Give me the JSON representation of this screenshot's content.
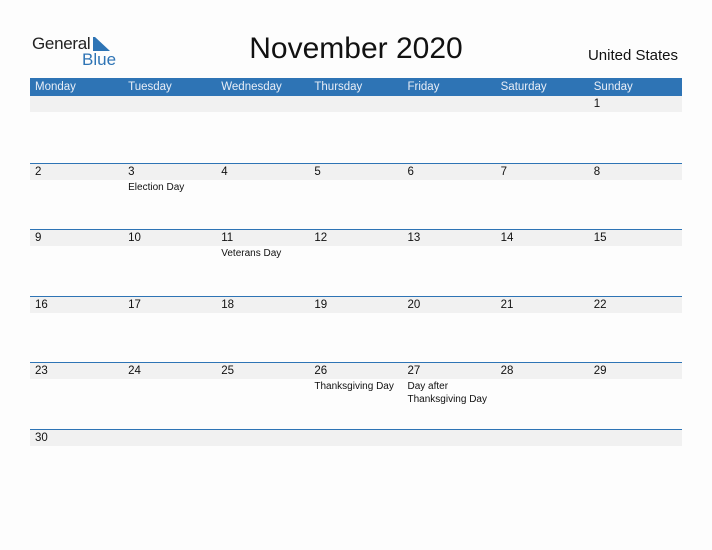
{
  "logo": {
    "line1": "General",
    "line2": "Blue"
  },
  "title": "November 2020",
  "country": "United States",
  "colors": {
    "accent": "#2e74b5",
    "band": "#f1f1f1"
  },
  "weekdays": [
    "Monday",
    "Tuesday",
    "Wednesday",
    "Thursday",
    "Friday",
    "Saturday",
    "Sunday"
  ],
  "weeks": [
    [
      {
        "day": ""
      },
      {
        "day": ""
      },
      {
        "day": ""
      },
      {
        "day": ""
      },
      {
        "day": ""
      },
      {
        "day": ""
      },
      {
        "day": "1"
      }
    ],
    [
      {
        "day": "2"
      },
      {
        "day": "3",
        "holiday": "Election Day"
      },
      {
        "day": "4"
      },
      {
        "day": "5"
      },
      {
        "day": "6"
      },
      {
        "day": "7"
      },
      {
        "day": "8"
      }
    ],
    [
      {
        "day": "9"
      },
      {
        "day": "10"
      },
      {
        "day": "11",
        "holiday": "Veterans Day"
      },
      {
        "day": "12"
      },
      {
        "day": "13"
      },
      {
        "day": "14"
      },
      {
        "day": "15"
      }
    ],
    [
      {
        "day": "16"
      },
      {
        "day": "17"
      },
      {
        "day": "18"
      },
      {
        "day": "19"
      },
      {
        "day": "20"
      },
      {
        "day": "21"
      },
      {
        "day": "22"
      }
    ],
    [
      {
        "day": "23"
      },
      {
        "day": "24"
      },
      {
        "day": "25"
      },
      {
        "day": "26",
        "holiday": "Thanksgiving Day"
      },
      {
        "day": "27",
        "holiday": "Day after Thanksgiving Day"
      },
      {
        "day": "28"
      },
      {
        "day": "29"
      }
    ],
    [
      {
        "day": "30"
      },
      {
        "day": ""
      },
      {
        "day": ""
      },
      {
        "day": ""
      },
      {
        "day": ""
      },
      {
        "day": ""
      },
      {
        "day": ""
      }
    ]
  ]
}
